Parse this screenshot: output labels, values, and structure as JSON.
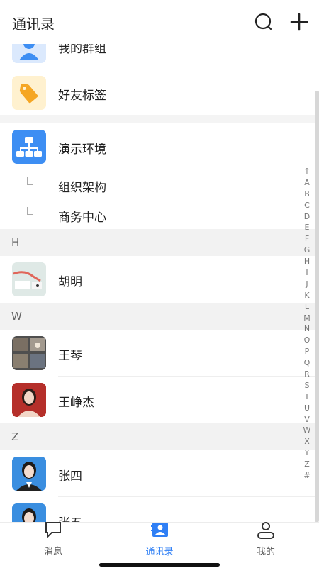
{
  "header": {
    "title": "通讯录",
    "search_icon": "search-icon",
    "add_icon": "plus-icon"
  },
  "groups": [
    {
      "label": "我的群组",
      "icon": "group-icon",
      "color": "#3d8ef3"
    },
    {
      "label": "好友标签",
      "icon": "tag-icon",
      "color": "#f5a623"
    }
  ],
  "org": {
    "label": "演示环境",
    "icon": "org-chart-icon",
    "color": "#3d8ef3",
    "children": [
      {
        "label": "组织架构"
      },
      {
        "label": "商务中心"
      }
    ]
  },
  "sections": [
    {
      "letter": "H",
      "contacts": [
        {
          "name": "胡明"
        }
      ]
    },
    {
      "letter": "W",
      "contacts": [
        {
          "name": "王琴"
        },
        {
          "name": "王峥杰"
        }
      ]
    },
    {
      "letter": "Z",
      "contacts": [
        {
          "name": "张四"
        },
        {
          "name": "张五"
        }
      ]
    }
  ],
  "index_letters": [
    "↑",
    "A",
    "B",
    "C",
    "D",
    "E",
    "F",
    "G",
    "H",
    "I",
    "J",
    "K",
    "L",
    "M",
    "N",
    "O",
    "P",
    "Q",
    "R",
    "S",
    "T",
    "U",
    "V",
    "W",
    "X",
    "Y",
    "Z",
    "#"
  ],
  "tabs": [
    {
      "label": "消息",
      "icon": "message-icon",
      "active": false
    },
    {
      "label": "通讯录",
      "icon": "contacts-icon",
      "active": true
    },
    {
      "label": "我的",
      "icon": "profile-icon",
      "active": false
    }
  ],
  "accent_color": "#2f7ff5"
}
